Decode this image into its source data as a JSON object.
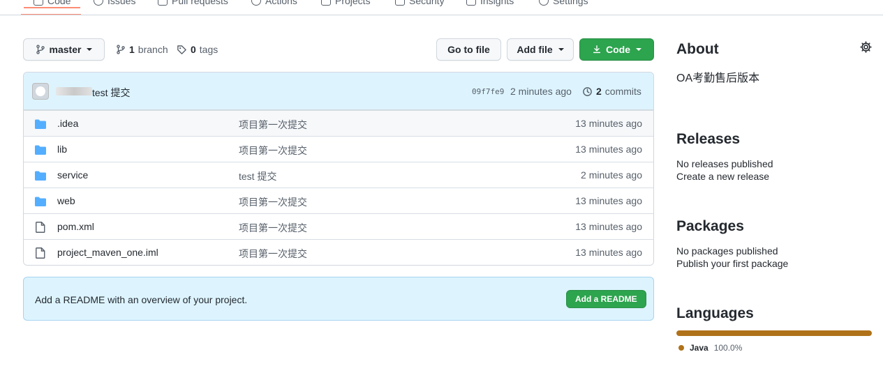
{
  "nav": {
    "tabs": [
      "Code",
      "Issues",
      "Pull requests",
      "Actions",
      "Projects",
      "Security",
      "Insights",
      "Settings"
    ]
  },
  "toolbar": {
    "branch": "master",
    "branch_count": "1",
    "branch_label": "branch",
    "tag_count": "0",
    "tag_label": "tags",
    "go_to_file": "Go to file",
    "add_file": "Add file",
    "code": "Code"
  },
  "commit": {
    "message": "test 提交",
    "sha": "09f7fe9",
    "time": "2 minutes ago",
    "count": "2",
    "count_label": "commits"
  },
  "files": [
    {
      "name": ".idea",
      "type": "folder",
      "message": "项目第一次提交",
      "time": "13 minutes ago"
    },
    {
      "name": "lib",
      "type": "folder",
      "message": "项目第一次提交",
      "time": "13 minutes ago"
    },
    {
      "name": "service",
      "type": "folder",
      "message": "test 提交",
      "time": "2 minutes ago"
    },
    {
      "name": "web",
      "type": "folder",
      "message": "项目第一次提交",
      "time": "13 minutes ago"
    },
    {
      "name": "pom.xml",
      "type": "file",
      "message": "项目第一次提交",
      "time": "13 minutes ago"
    },
    {
      "name": "project_maven_one.iml",
      "type": "file",
      "message": "项目第一次提交",
      "time": "13 minutes ago"
    }
  ],
  "readme": {
    "text": "Add a README with an overview of your project.",
    "button": "Add a README"
  },
  "sidebar": {
    "about_title": "About",
    "description": "OA考勤售后版本",
    "releases_title": "Releases",
    "releases_none": "No releases published",
    "releases_link": "Create a new release",
    "packages_title": "Packages",
    "packages_none": "No packages published",
    "packages_link": "Publish your first package",
    "languages_title": "Languages",
    "language_name": "Java",
    "language_pct": "100.0%",
    "language_share": 100
  },
  "colors": {
    "accent_green": "#2da44e",
    "link_blue": "#0969da",
    "java": "#b07219",
    "commit_bar": "#ddf4ff",
    "folder": "#54aeff"
  }
}
